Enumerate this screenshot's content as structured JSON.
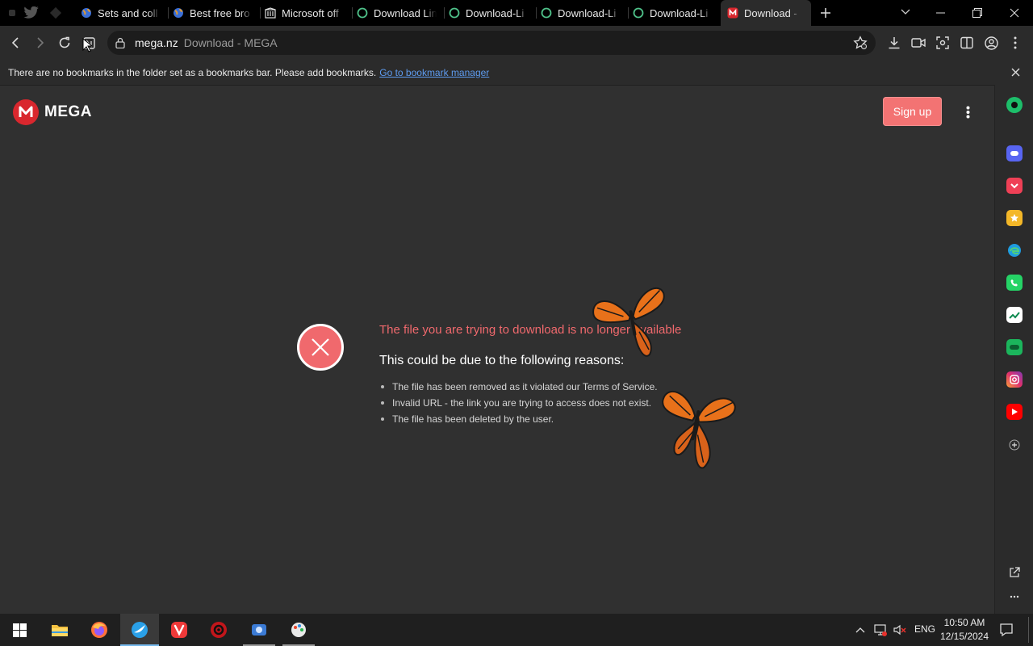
{
  "browser": {
    "tabs": [
      {
        "label": "Sets and coll",
        "favicon": "globe-icon"
      },
      {
        "label": "Best free bro",
        "favicon": "globe-icon"
      },
      {
        "label": "Microsoft off",
        "favicon": "building-icon"
      },
      {
        "label": "Download Lin",
        "favicon": "circle-icon"
      },
      {
        "label": "Download-Li",
        "favicon": "circle-icon"
      },
      {
        "label": "Download-Li",
        "favicon": "circle-icon"
      },
      {
        "label": "Download-Li",
        "favicon": "circle-icon"
      },
      {
        "label": "Download - ",
        "favicon": "mega-icon",
        "active": true
      }
    ],
    "address": {
      "domain": "mega.nz",
      "title": "Download - MEGA"
    },
    "bookmarks_bar": {
      "message": "There are no bookmarks in the folder set as a bookmarks bar. Please add bookmarks.",
      "link": "Go to bookmark manager"
    }
  },
  "page": {
    "brand": "MEGA",
    "signup_label": "Sign up",
    "error_title": "The file you are trying to download is no longer available",
    "reasons_heading": "This could be due to the following reasons:",
    "reasons": [
      "The file has been removed as it violated our Terms of Service.",
      "Invalid URL - the link you are trying to access does not exist.",
      "The file has been deleted by the user."
    ]
  },
  "taskbar": {
    "language": "ENG",
    "time": "10:50 AM",
    "date": "12/15/2024"
  },
  "colors": {
    "mega_red": "#d9272e",
    "error_red": "#f0696d",
    "signup_bg": "#f37373",
    "link_blue": "#5e9cf0"
  }
}
